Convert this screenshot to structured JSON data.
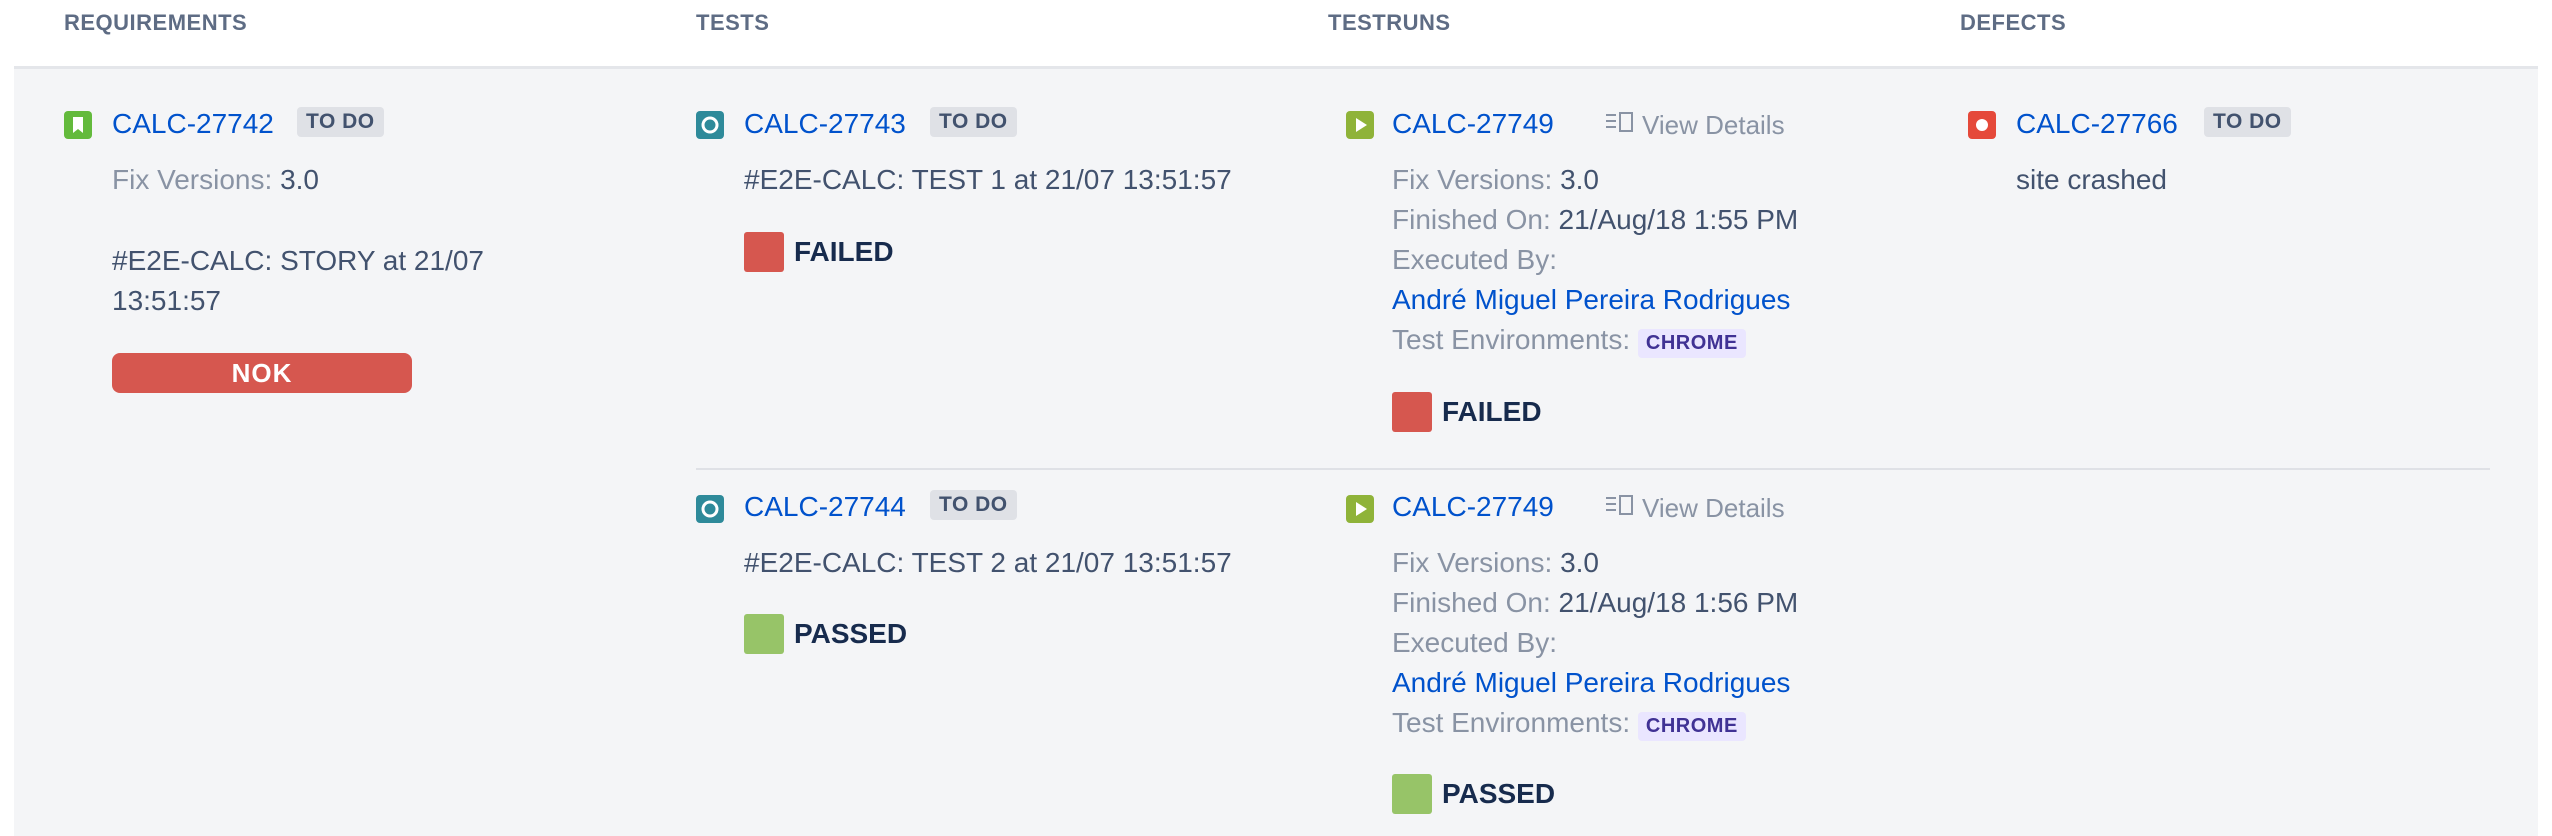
{
  "headers": {
    "requirements": "REQUIREMENTS",
    "tests": "TESTS",
    "testruns": "TESTRUNS",
    "defects": "DEFECTS"
  },
  "colors": {
    "failed": "#d6574f",
    "passed": "#97c468",
    "link": "#0052cc",
    "story_icon": "#63ba3c",
    "test_icon": "#2e8a9a",
    "testrun_icon": "#8fb339",
    "defect_icon": "#e5493a"
  },
  "requirement": {
    "icon": "story-icon",
    "key": "CALC-27742",
    "status": "TO DO",
    "fix_versions_label": "Fix Versions:",
    "fix_versions_value": "3.0",
    "summary_line1": "#E2E-CALC: STORY at 21/07",
    "summary_line2": "13:51:57",
    "result": "NOK"
  },
  "tests": [
    {
      "icon": "test-icon",
      "key": "CALC-27743",
      "status": "TO DO",
      "summary": "#E2E-CALC: TEST 1 at 21/07 13:51:57",
      "result": "FAILED"
    },
    {
      "icon": "test-icon",
      "key": "CALC-27744",
      "status": "TO DO",
      "summary": "#E2E-CALC: TEST 2 at 21/07 13:51:57",
      "result": "PASSED"
    }
  ],
  "testruns": [
    {
      "icon": "testrun-icon",
      "key": "CALC-27749",
      "view_details": "View Details",
      "fix_versions_label": "Fix Versions:",
      "fix_versions_value": "3.0",
      "finished_label": "Finished On:",
      "finished_value": "21/Aug/18 1:55 PM",
      "executed_label": "Executed By:",
      "executed_value": "André Miguel Pereira Rodrigues",
      "env_label": "Test Environments:",
      "env_value": "CHROME",
      "result": "FAILED"
    },
    {
      "icon": "testrun-icon",
      "key": "CALC-27749",
      "view_details": "View Details",
      "fix_versions_label": "Fix Versions:",
      "fix_versions_value": "3.0",
      "finished_label": "Finished On:",
      "finished_value": "21/Aug/18 1:56 PM",
      "executed_label": "Executed By:",
      "executed_value": "André Miguel Pereira Rodrigues",
      "env_label": "Test Environments:",
      "env_value": "CHROME",
      "result": "PASSED"
    }
  ],
  "defect": {
    "icon": "bug-icon",
    "key": "CALC-27766",
    "status": "TO DO",
    "summary": "site crashed"
  }
}
